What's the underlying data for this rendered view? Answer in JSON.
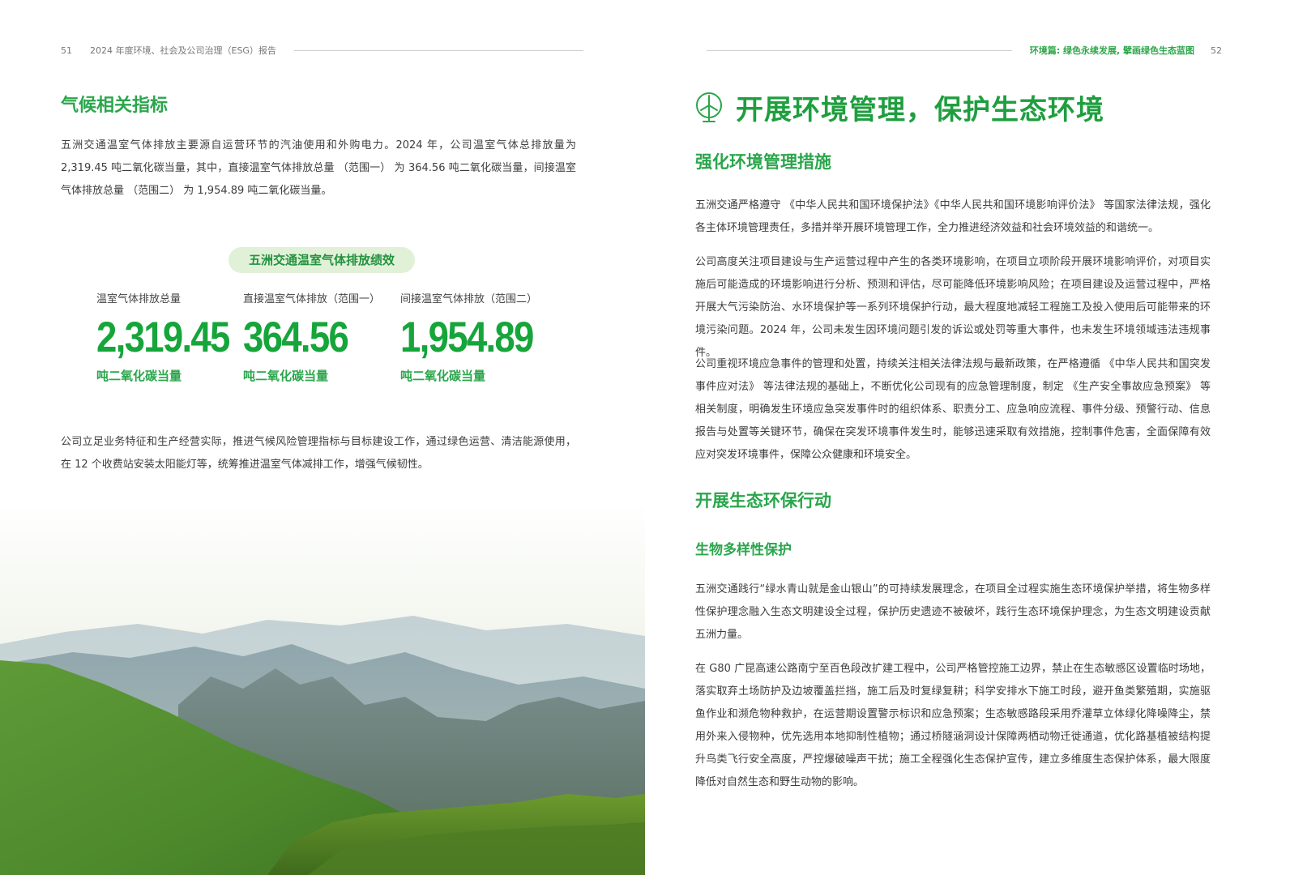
{
  "left": {
    "page_number": "51",
    "report_title": "2024 年度环境、社会及公司治理（ESG）报告",
    "section_heading": "气候相关指标",
    "intro": "五洲交通温室气体排放主要源自运营环节的汽油使用和外购电力。2024 年，公司温室气体总排放量为 2,319.45 吨二氧化碳当量，其中，直接温室气体排放总量 （范围一） 为 364.56 吨二氧化碳当量，间接温室气体排放总量 （范围二） 为 1,954.89 吨二氧化碳当量。",
    "pill": "五洲交通温室气体排放绩效",
    "metrics": [
      {
        "label": "温室气体排放总量",
        "value": "2,319.45",
        "unit": "吨二氧化碳当量"
      },
      {
        "label": "直接温室气体排放（范围一）",
        "value": "364.56",
        "unit": "吨二氧化碳当量"
      },
      {
        "label": "间接温室气体排放（范围二）",
        "value": "1,954.89",
        "unit": "吨二氧化碳当量"
      }
    ],
    "closing": "公司立足业务特征和生产经营实际，推进气候风险管理指标与目标建设工作，通过绿色运营、清洁能源使用，在 12 个收费站安装太阳能灯等，统筹推进温室气体减排工作，增强气候韧性。"
  },
  "right": {
    "page_number": "52",
    "section_name": "环境篇: 绿色永续发展, 擘画绿色生态蓝图",
    "icon": "wind-turbine-icon",
    "title": "开展环境管理，保护生态环境",
    "h2_measures": "强化环境管理措施",
    "p1": "五洲交通严格遵守 《中华人民共和国环境保护法》《中华人民共和国环境影响评价法》 等国家法律法规，强化各主体环境管理责任，多措并举开展环境管理工作，全力推进经济效益和社会环境效益的和谐统一。",
    "p2": "公司高度关注项目建设与生产运营过程中产生的各类环境影响，在项目立项阶段开展环境影响评价，对项目实施后可能造成的环境影响进行分析、预测和评估，尽可能降低环境影响风险；在项目建设及运营过程中，严格开展大气污染防治、水环境保护等一系列环境保护行动，最大程度地减轻工程施工及投入使用后可能带来的环境污染问题。2024 年，公司未发生因环境问题引发的诉讼或处罚等重大事件，也未发生环境领域违法违规事件。",
    "p3": "公司重视环境应急事件的管理和处置，持续关注相关法律法规与最新政策，在严格遵循 《中华人民共和国突发事件应对法》 等法律法规的基础上，不断优化公司现有的应急管理制度，制定 《生产安全事故应急预案》 等相关制度，明确发生环境应急突发事件时的组织体系、职责分工、应急响应流程、事件分级、预警行动、信息报告与处置等关键环节，确保在突发环境事件发生时，能够迅速采取有效措施，控制事件危害，全面保障有效应对突发环境事件，保障公众健康和环境安全。",
    "h2_eco": "开展生态环保行动",
    "h3_bio": "生物多样性保护",
    "p4": "五洲交通践行“绿水青山就是金山银山”的可持续发展理念，在项目全过程实施生态环境保护举措，将生物多样性保护理念融入生态文明建设全过程，保护历史遗迹不被破坏，践行生态环境保护理念，为生态文明建设贡献五洲力量。",
    "p5": "在 G80 广昆高速公路南宁至百色段改扩建工程中，公司严格管控施工边界，禁止在生态敏感区设置临时场地，落实取弃土场防护及边坡覆盖拦挡，施工后及时复绿复耕；科学安排水下施工时段，避开鱼类繁殖期，实施驱鱼作业和濒危物种救护，在运营期设置警示标识和应急预案；生态敏感路段采用乔灌草立体绿化降噪降尘，禁用外来入侵物种，优先选用本地抑制性植物；通过桥隧涵洞设计保障两栖动物迁徙通道，优化路基植被结构提升鸟类飞行安全高度，严控爆破噪声干扰；施工全程强化生态保护宣传，建立多维度生态保护体系，最大限度降低对自然生态和野生动物的影响。"
  }
}
